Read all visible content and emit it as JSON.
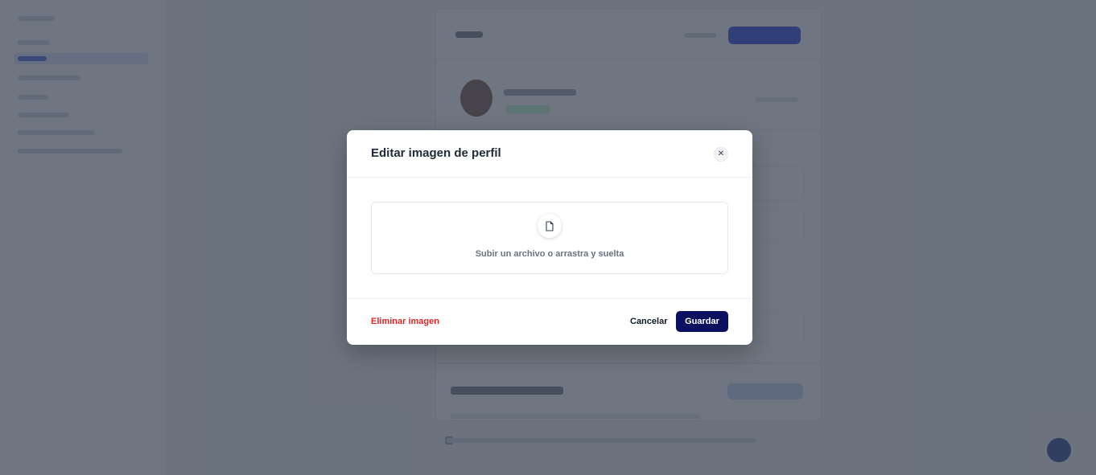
{
  "modal": {
    "title": "Editar imagen de perfil",
    "close_icon": "close-icon",
    "upload": {
      "icon": "document-icon",
      "text": "Subir un archivo o arrastra y suelta"
    },
    "remove_label": "Eliminar imagen",
    "cancel_label": "Cancelar",
    "save_label": "Guardar"
  },
  "colors": {
    "primary_button": "#0b1160",
    "danger_text": "#dc2626",
    "overlay": "rgba(55,65,81,0.72)"
  }
}
